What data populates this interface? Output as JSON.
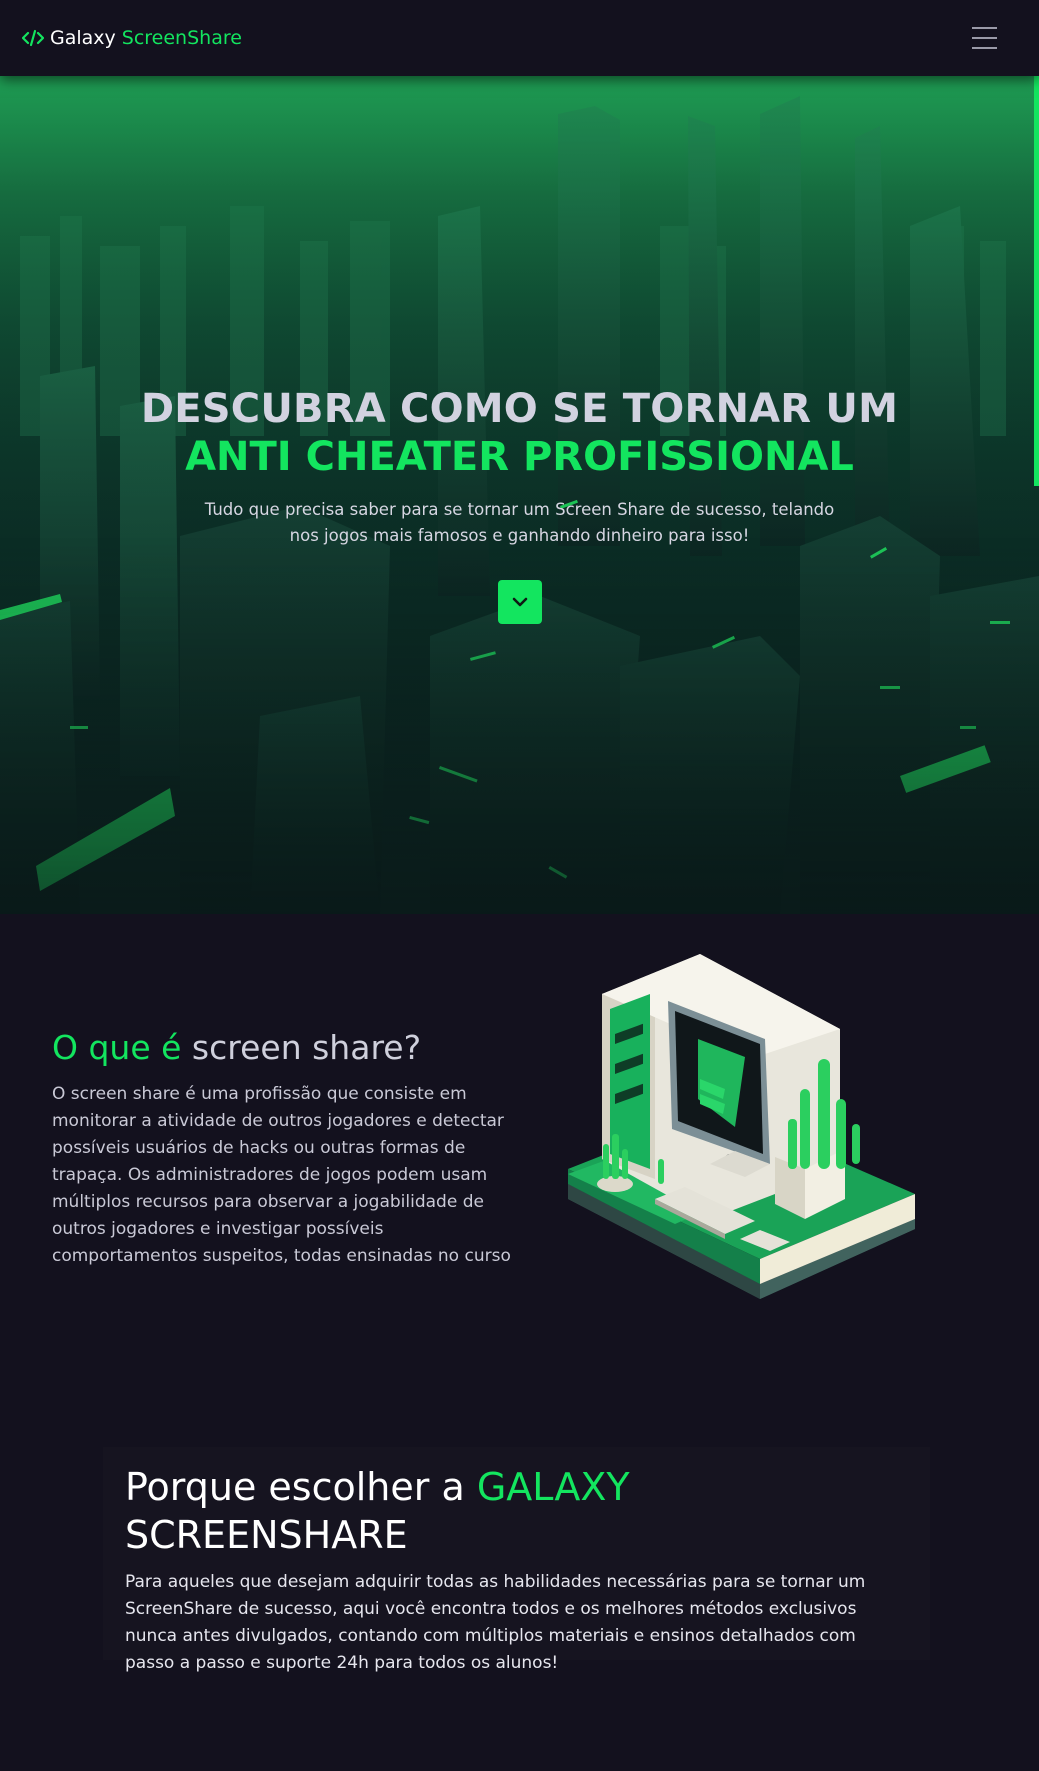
{
  "navbar": {
    "brand_primary": "Galaxy",
    "brand_accent": "ScreenShare",
    "logo_icon": "code-brackets-icon",
    "menu_icon": "hamburger-menu-icon"
  },
  "hero": {
    "title_line1": "DESCUBRA COMO SE TORNAR UM",
    "title_line2": "ANTI CHEATER PROFISSIONAL",
    "subtitle": "Tudo que precisa saber para se tornar um Screen Share de sucesso, telando nos jogos mais famosos e ganhando dinheiro para isso!",
    "scroll_button_icon": "chevron-down-icon"
  },
  "about": {
    "heading_accent": "O que é",
    "heading_rest": "screen share?",
    "body": "O screen share é uma profissão que consiste em monitorar a atividade de outros jogadores e detectar possíveis usuários de hacks ou outras formas de trapaça. Os administradores de jogos podem usam múltiplos recursos para observar a jogabilidade de outros jogadores e investigar possíveis comportamentos suspeitos, todas ensinadas no curso"
  },
  "why": {
    "heading_prefix": "Porque escolher a",
    "heading_accent": "GALAXY",
    "heading_suffix": "SCREENSHARE",
    "body": "Para aqueles que desejam adquirir todas as habilidades necessárias para se tornar um ScreenShare de sucesso, aqui você encontra todos e os melhores métodos exclusivos nunca antes divulgados, contando com múltiplos materiais e ensinos detalhados com passo a passo e suporte 24h para todos os alunos!"
  },
  "colors": {
    "background": "#13111e",
    "accent": "#13e55f",
    "card": "#161420"
  }
}
